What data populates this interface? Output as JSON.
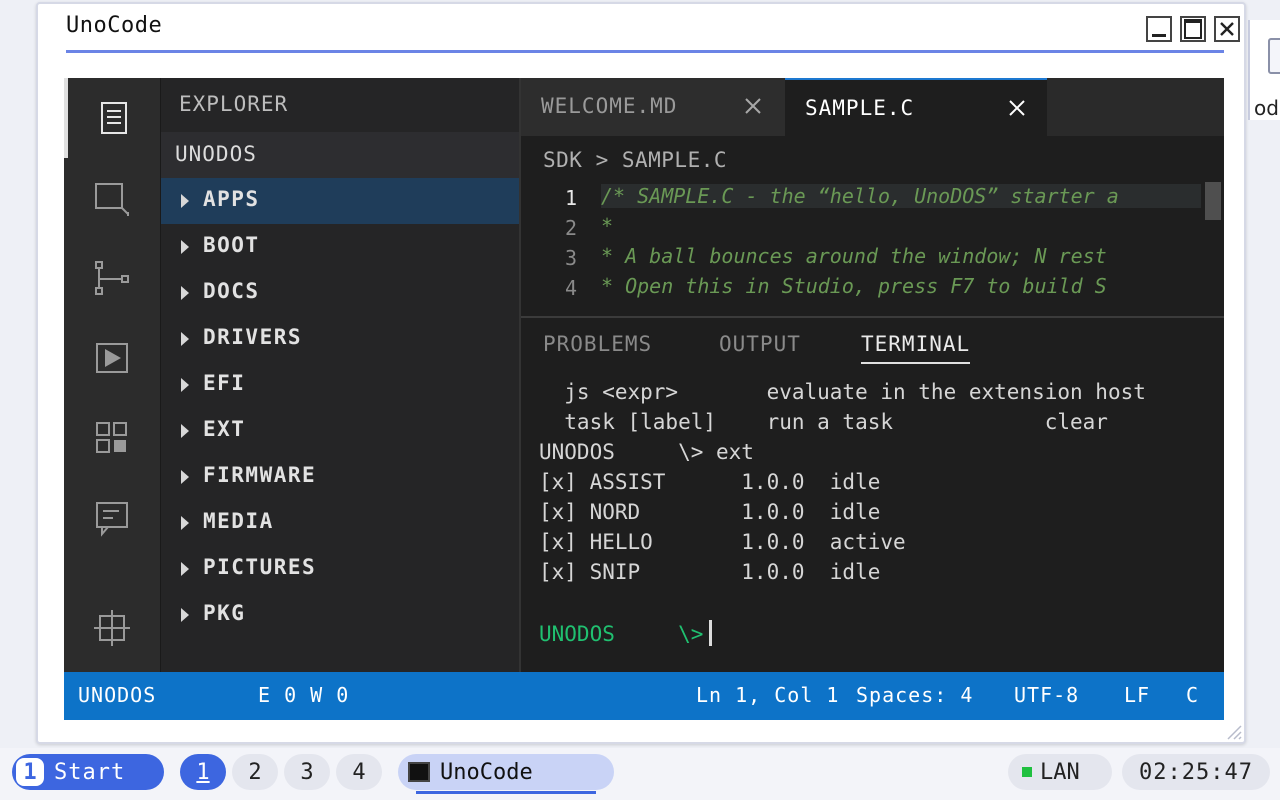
{
  "background_window": {
    "partial_text": "od"
  },
  "window": {
    "title": "UnoCode"
  },
  "sidebar": {
    "title": "EXPLORER",
    "root": "UNODOS",
    "items": [
      {
        "label": "APPS",
        "selected": true
      },
      {
        "label": "BOOT"
      },
      {
        "label": "DOCS"
      },
      {
        "label": "DRIVERS"
      },
      {
        "label": "EFI"
      },
      {
        "label": "EXT"
      },
      {
        "label": "FIRMWARE"
      },
      {
        "label": "MEDIA"
      },
      {
        "label": "PICTURES"
      },
      {
        "label": "PKG"
      }
    ]
  },
  "activity_bar": [
    "files-icon",
    "search-icon",
    "source-control-icon",
    "run-icon",
    "extensions-icon",
    "chat-icon",
    "settings-crosshair-icon"
  ],
  "editor": {
    "tabs": [
      {
        "label": "WELCOME.MD",
        "active": false
      },
      {
        "label": "SAMPLE.C",
        "active": true
      }
    ],
    "breadcrumb": "SDK > SAMPLE.C",
    "lines": [
      {
        "n": "1",
        "text": "/* SAMPLE.C - the “hello, UnoDOS” starter a"
      },
      {
        "n": "2",
        "text": " *"
      },
      {
        "n": "3",
        "text": " * A ball bounces around the window; N rest"
      },
      {
        "n": "4",
        "text": " * Open this in Studio, press F7 to build S"
      }
    ]
  },
  "panel": {
    "tabs": [
      "PROBLEMS",
      "OUTPUT",
      "TERMINAL"
    ],
    "active_tab": "TERMINAL",
    "terminal_lines": [
      "  js <expr>       evaluate in the extension host",
      "  task [label]    run a task            clear",
      "UNODOS     \\> ext",
      "[x] ASSIST      1.0.0  idle",
      "[x] NORD        1.0.0  idle",
      "[x] HELLO       1.0.0  active",
      "[x] SNIP        1.0.0  idle",
      ""
    ],
    "prompt": "UNODOS     \\>"
  },
  "status": {
    "workspace": "UNODOS",
    "problems": "E 0  W 0",
    "position": "Ln 1, Col 1",
    "spaces": "Spaces: 4",
    "encoding": "UTF-8",
    "eol": "LF",
    "language": "C"
  },
  "taskbar": {
    "start_num": "1",
    "start_label": "Start",
    "workspaces": [
      "1",
      "2",
      "3",
      "4"
    ],
    "active_workspace": "1",
    "app": "UnoCode",
    "network": "LAN",
    "clock": "02:25:47"
  },
  "colors": {
    "accent": "#3d66e0",
    "status_bar": "#0d73c8",
    "comment": "#6a9955",
    "prompt": "#20c070"
  }
}
